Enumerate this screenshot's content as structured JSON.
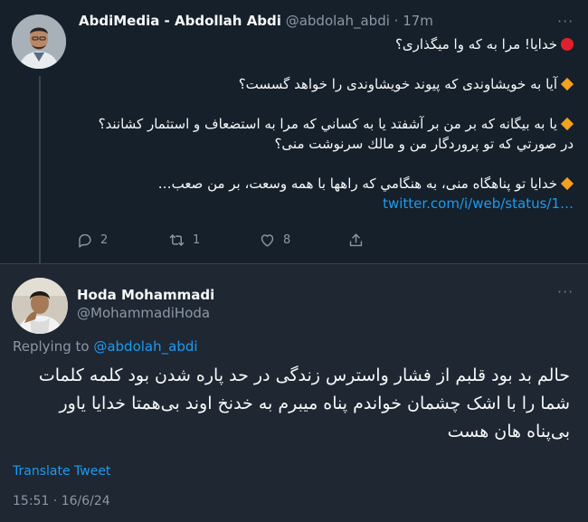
{
  "tweet": {
    "author_name": "AbdiMedia - Abdollah Abdi",
    "author_handle": "@abdolah_abdi",
    "separator": " · ",
    "time_ago": "17m",
    "more": "···",
    "lines": [
      "خدایا! مرا به که وا میگذاری؟",
      "",
      "آیا به خویشاوندی که پیوند خویشاوندی را خواهد گسست؟",
      "",
      "یا به بیگانه که بر من بر آشفتد یا به کساني که مرا به استضعاف و استثمار کشانند؟",
      "در صورتي که تو پروردگار من و مالك سرنوشت منی؟",
      "",
      "خدایا تو پناهگاه منی، به هنگامي که راهها با همه وسعت، بر من صعب…",
      "twitter.com/i/web/status/1…"
    ],
    "actions": {
      "reply_count": "2",
      "retweet_count": "1",
      "like_count": "8"
    }
  },
  "reply": {
    "author_name": "Hoda Mohammadi",
    "author_handle": "@MohammadiHoda",
    "more": "···",
    "replying_prefix": "Replying to ",
    "replying_handle": "@abdolah_abdi",
    "text": "حالم بد بود قلبم از فشار واسترس زندگی در حد پاره شدن بود کلمه کلمات شما را با اشک چشمان خواندم پناه میبرم به خدنخ اوند بی‌همتا خدایا یاور بی‌پناه هان هست",
    "translate_label": "Translate Tweet",
    "timestamp": "15:51 · 16/6/24"
  },
  "colors": {
    "background": "#15202b",
    "reply_background": "#1e2732",
    "accent": "#1d9bf0",
    "muted": "#8b98a5",
    "red_circle": "#e0212b",
    "orange_diamond": "#f4a11c"
  },
  "icons": [
    "red-circle-emoji-icon",
    "orange-diamond-emoji-icon",
    "reply-icon",
    "retweet-icon",
    "like-icon",
    "share-icon",
    "more-icon"
  ]
}
